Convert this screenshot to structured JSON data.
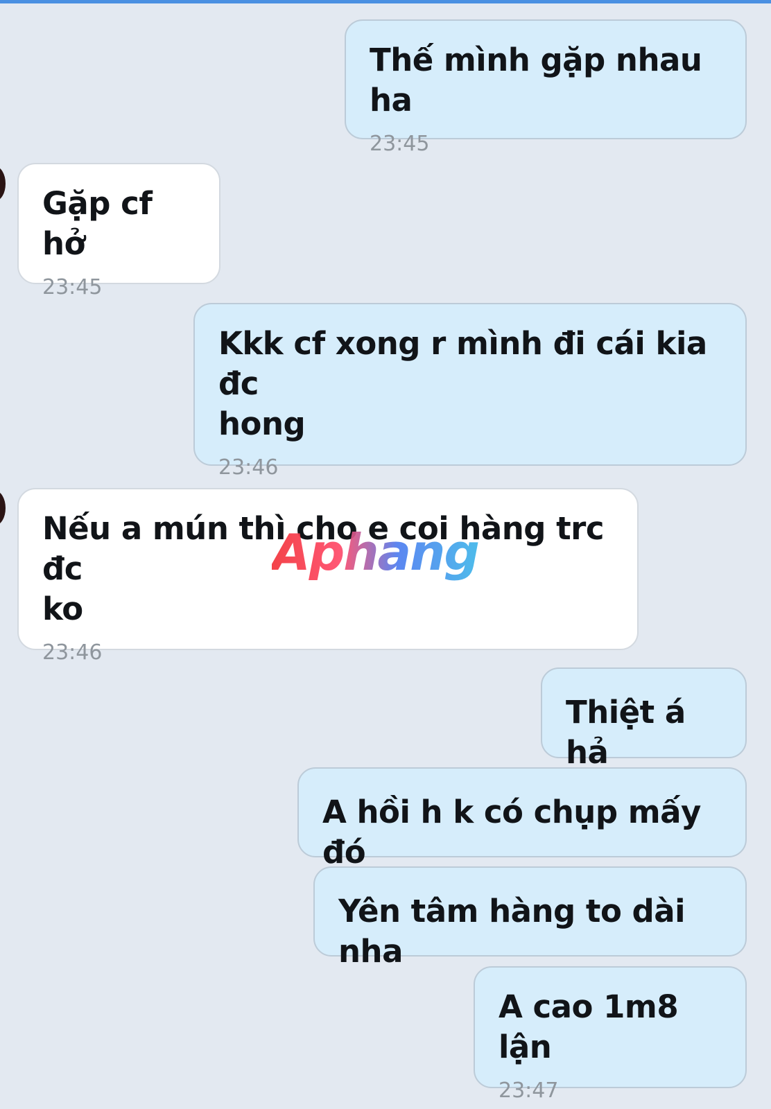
{
  "chat": {
    "messages": [
      {
        "text": "Thế mình gặp nhau ha",
        "time": "23:45"
      },
      {
        "text": "Gặp cf hở",
        "time": "23:45"
      },
      {
        "text": "Kkk cf xong r mình đi cái kia đc\nhong",
        "time": "23:46"
      },
      {
        "text": "Nếu a mún thì cho e coi hàng trc đc\nko",
        "time": "23:46"
      },
      {
        "text": "Thiệt á hả"
      },
      {
        "text": "A hồi h k có chụp mấy đó"
      },
      {
        "text": "Yên tâm hàng to dài nha"
      },
      {
        "text": "A cao 1m8 lận",
        "time": "23:47"
      }
    ]
  },
  "watermark": {
    "text": "Aphang"
  },
  "colors": {
    "background": "#e3e9f1",
    "sent_bubble": "#d6edfb",
    "received_bubble": "#ffffff",
    "top_bar": "#4a90e2"
  }
}
